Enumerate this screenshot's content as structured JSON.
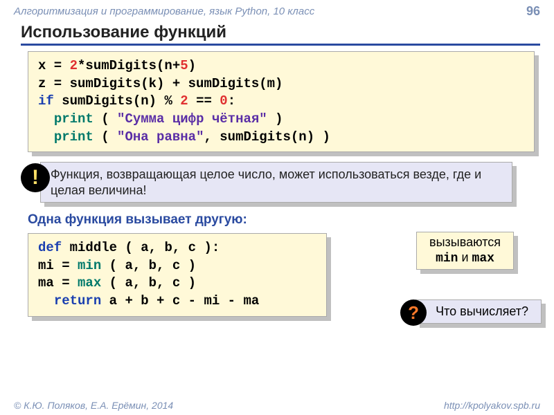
{
  "header": {
    "course": "Алгоритмизация и программирование, язык Python, 10 класс",
    "page": "96"
  },
  "title": "Использование функций",
  "code1": {
    "l1a": "x = ",
    "l1b": "2",
    "l1c": "*sumDigits(n+",
    "l1d": "5",
    "l1e": ")",
    "l2": "z = sumDigits(k) + sumDigits(m)",
    "l3a": "if",
    "l3b": " sumDigits(n)",
    "l3c": " % ",
    "l3d": "2",
    "l3e": " == ",
    "l3f": "0",
    "l3g": ":",
    "l4a": "print",
    "l4b": " ( ",
    "l4c": "\"Сумма цифр чётная\"",
    "l4d": " )",
    "l5a": "print",
    "l5b": " ( ",
    "l5c": "\"Она равна\"",
    "l5d": ", sumDigits(n) )"
  },
  "note": {
    "badge": "!",
    "text": "Функция, возвращающая целое число, может использоваться везде, где и целая величина!"
  },
  "subhead": "Одна функция вызывает другую:",
  "code2": {
    "l1a": "def",
    "l1b": " middle ( a, b, c ):",
    "l2a": "  mi = ",
    "l2b": "min",
    "l2c": " ( a, b, c )",
    "l3a": "  ma = ",
    "l3b": "max",
    "l3c": " ( a, b, c )",
    "l4a": "return",
    "l4b": " a + b + c - mi - ma"
  },
  "callout1": {
    "line1": "вызываются",
    "line2a": "min",
    "line2b": " и ",
    "line2c": "max"
  },
  "callout2": {
    "badge": "?",
    "text": "Что вычисляет?"
  },
  "footer": {
    "left": "© К.Ю. Поляков, Е.А. Ерёмин, 2014",
    "right": "http://kpolyakov.spb.ru"
  }
}
